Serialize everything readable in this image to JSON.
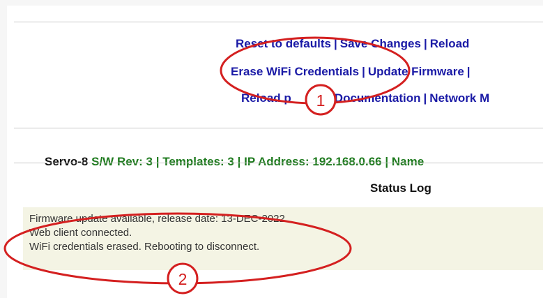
{
  "menu": {
    "row1": [
      "Reset to defaults",
      "Save Changes",
      "Reload"
    ],
    "row2": [
      "Erase WiFi Credentials",
      "Update Firmware"
    ],
    "row3": [
      "Reload p",
      "Documentation",
      "Network M"
    ]
  },
  "device_info": {
    "name": "Servo-8",
    "sw_rev": "S/W Rev: 3",
    "templates": "Templates: 3",
    "ip": "IP Address: 192.168.0.66",
    "name_label": "Name"
  },
  "status": {
    "title": "Status Log",
    "lines": [
      "Firmware update available, release date: 13-DEC-2022",
      "Web client connected.",
      "WiFi credentials erased. Rebooting to disconnect."
    ]
  },
  "annotations": {
    "badge1": "1",
    "badge2": "2",
    "color": "#d42020"
  },
  "colors": {
    "link": "#1a1aa6",
    "green": "#1e7a1e",
    "log_bg": "#f4f4e4"
  }
}
